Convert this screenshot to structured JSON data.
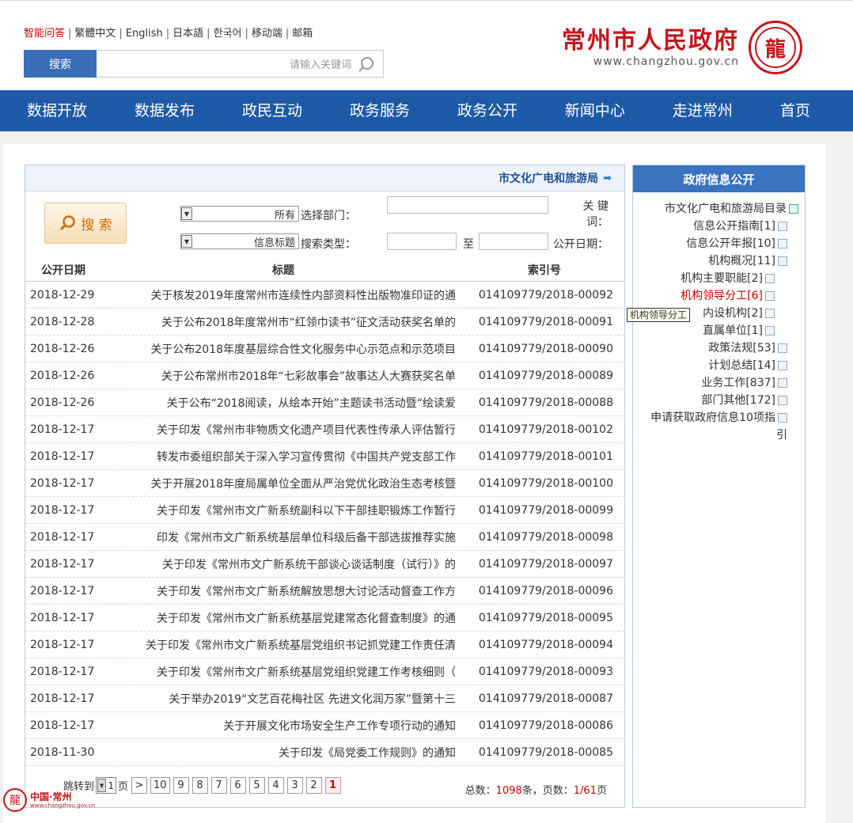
{
  "header": {
    "top_links": [
      "智能问答",
      "繁體中文",
      "English",
      "日本語",
      "한국어",
      "移动端",
      "邮箱"
    ],
    "search_button": "搜索",
    "search_placeholder": "请输入关键词",
    "logo_title": "常州市人民政府",
    "logo_url": "www.changzhou.gov.cn",
    "seal_char": "龍"
  },
  "nav": [
    "首页",
    "走进常州",
    "新闻中心",
    "政务公开",
    "政务服务",
    "政民互动",
    "数据发布",
    "数据开放"
  ],
  "sidebar": {
    "title": "政府信息公开",
    "tooltip": "机构领导分工",
    "items": [
      {
        "label": "市文化广电和旅游局目录",
        "level": 1
      },
      {
        "label": "信息公开指南[1]",
        "level": 2
      },
      {
        "label": "信息公开年报[10]",
        "level": 2
      },
      {
        "label": "机构概况[11]",
        "level": 2
      },
      {
        "label": "机构主要职能[2]",
        "level": 3
      },
      {
        "label": "机构领导分工[6]",
        "level": 3,
        "active": true
      },
      {
        "label": "内设机构[2]",
        "level": 3
      },
      {
        "label": "直属单位[1]",
        "level": 3
      },
      {
        "label": "政策法规[53]",
        "level": 2
      },
      {
        "label": "计划总结[14]",
        "level": 2
      },
      {
        "label": "业务工作[837]",
        "level": 2
      },
      {
        "label": "部门其他[172]",
        "level": 2
      },
      {
        "label": "申请获取政府信息10项指",
        "level": 2
      },
      {
        "label": "引",
        "level": 2
      }
    ]
  },
  "main": {
    "breadcrumb": "市文化广电和旅游局",
    "form": {
      "keyword_label": "关 键",
      "keyword_label2": "词：",
      "date_label": "公开日期：",
      "date_to": "至",
      "dept_label": "选择部门：",
      "dept_value": "所有",
      "type_label": "搜索类型：",
      "type_value": "信息标题",
      "search_button": "搜 索"
    },
    "table": {
      "headers": {
        "index": "索引号",
        "title": "标题",
        "date": "公开日期"
      },
      "rows": [
        {
          "index": "014109779/2018-00092",
          "title": "关于核发2019年度常州市连续性内部资料性出版物准印证的通",
          "date": "2018-12-29"
        },
        {
          "index": "014109779/2018-00091",
          "title": "关于公布2018年度常州市“红领巾读书”征文活动获奖名单的",
          "date": "2018-12-28"
        },
        {
          "index": "014109779/2018-00090",
          "title": "关于公布2018年度基层综合性文化服务中心示范点和示范项目",
          "date": "2018-12-26"
        },
        {
          "index": "014109779/2018-00089",
          "title": "关于公布常州市2018年“七彩故事会”故事达人大赛获奖名单",
          "date": "2018-12-26"
        },
        {
          "index": "014109779/2018-00088",
          "title": "关于公布“2018阅读，从绘本开始”主题读书活动暨“绘读爱",
          "date": "2018-12-26"
        },
        {
          "index": "014109779/2018-00102",
          "title": "关于印发《常州市非物质文化遗产项目代表性传承人评估暂行",
          "date": "2018-12-17"
        },
        {
          "index": "014109779/2018-00101",
          "title": "转发市委组织部关于深入学习宣传贯彻《中国共产党支部工作",
          "date": "2018-12-17"
        },
        {
          "index": "014109779/2018-00100",
          "title": "关于开展2018年度局属单位全面从严治党优化政治生态考核暨",
          "date": "2018-12-17"
        },
        {
          "index": "014109779/2018-00099",
          "title": "关于印发《常州市文广新系统副科以下干部挂职锻炼工作暂行",
          "date": "2018-12-17"
        },
        {
          "index": "014109779/2018-00098",
          "title": "印发《常州市文广新系统基层单位科级后备干部选拔推荐实施",
          "date": "2018-12-17"
        },
        {
          "index": "014109779/2018-00097",
          "title": "关于印发《常州市文广新系统干部谈心谈话制度（试行）》的",
          "date": "2018-12-17"
        },
        {
          "index": "014109779/2018-00096",
          "title": "关于印发《常州市文广新系统解放思想大讨论活动督查工作方",
          "date": "2018-12-17"
        },
        {
          "index": "014109779/2018-00095",
          "title": "关于印发《常州市文广新系统基层党建常态化督查制度》的通",
          "date": "2018-12-17"
        },
        {
          "index": "014109779/2018-00094",
          "title": "关于印发《常州市文广新系统基层党组织书记抓党建工作责任清",
          "date": "2018-12-17"
        },
        {
          "index": "014109779/2018-00093",
          "title": "关于印发《常州市文广新系统基层党组织党建工作考核细则（",
          "date": "2018-12-17"
        },
        {
          "index": "014109779/2018-00087",
          "title": "关于举办2019“文艺百花梅社区 先进文化润万家”暨第十三",
          "date": "2018-12-17"
        },
        {
          "index": "014109779/2018-00086",
          "title": "关于开展文化市场安全生产工作专项行动的通知",
          "date": "2018-12-17"
        },
        {
          "index": "014109779/2018-00085",
          "title": "关于印发《局党委工作规则》的通知",
          "date": "2018-11-30"
        }
      ]
    },
    "pager": {
      "total_label": "总数：",
      "total": "1098",
      "mid": "条，页数：",
      "page_info": "1/61",
      "page_suffix": "页",
      "pages": [
        "1",
        "2",
        "3",
        "4",
        "5",
        "6",
        "7",
        "8",
        "9",
        "10",
        ">"
      ],
      "current": "1",
      "jump_label": "跳转到",
      "jump_value": "1",
      "jump_suffix": "页"
    }
  },
  "watermark": {
    "text": "中国·常州",
    "url": "www.changzhou.gov.cn",
    "seal": "龍"
  }
}
